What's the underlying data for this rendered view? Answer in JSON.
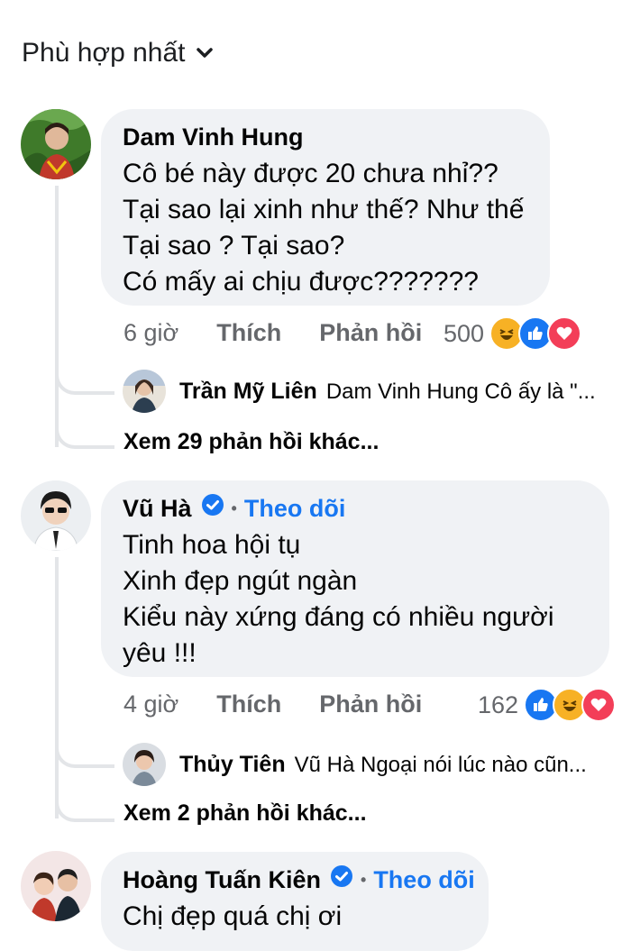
{
  "sort": {
    "label": "Phù hợp nhất"
  },
  "comments": [
    {
      "author": "Dam Vinh Hung",
      "lines": [
        "Cô bé này được 20 chưa nhỉ??",
        "Tại sao lại xinh như thế? Như thế",
        "Tại sao ? Tại sao?",
        "Có mấy ai chịu được???????"
      ],
      "time": "6 giờ",
      "like_label": "Thích",
      "reply_label": "Phản hồi",
      "reaction_count": "500",
      "reactions": [
        "haha",
        "like",
        "love"
      ],
      "reply_preview": {
        "author": "Trần Mỹ Liên",
        "text": "Dam Vinh Hung Cô ấy là \"..."
      },
      "more_replies": "Xem 29 phản hồi khác..."
    },
    {
      "author": "Vũ Hà",
      "verified": true,
      "follow_label": "Theo dõi",
      "lines": [
        "Tinh hoa hội tụ",
        "Xinh đẹp ngút ngàn",
        "Kiểu này xứng đáng có nhiều người",
        "yêu !!!"
      ],
      "time": "4 giờ",
      "like_label": "Thích",
      "reply_label": "Phản hồi",
      "reaction_count": "162",
      "reactions": [
        "like",
        "haha",
        "love"
      ],
      "reply_preview": {
        "author": "Thủy Tiên",
        "text": "Vũ Hà Ngoại nói lúc nào cũn..."
      },
      "more_replies": "Xem 2 phản hồi khác..."
    },
    {
      "author": "Hoàng Tuấn Kiên",
      "verified": true,
      "follow_label": "Theo dõi",
      "lines": [
        "Chị đẹp quá chị ơi"
      ]
    }
  ],
  "icons": {
    "chevron": "chevron-down-icon",
    "verified": "verified-badge-icon",
    "like": "like-reaction-icon",
    "haha": "haha-reaction-icon",
    "love": "love-reaction-icon"
  },
  "colors": {
    "link": "#1877f2",
    "bubble": "#f0f2f5",
    "muted": "#65676b",
    "love": "#f33e58",
    "haha": "#f7b125"
  }
}
